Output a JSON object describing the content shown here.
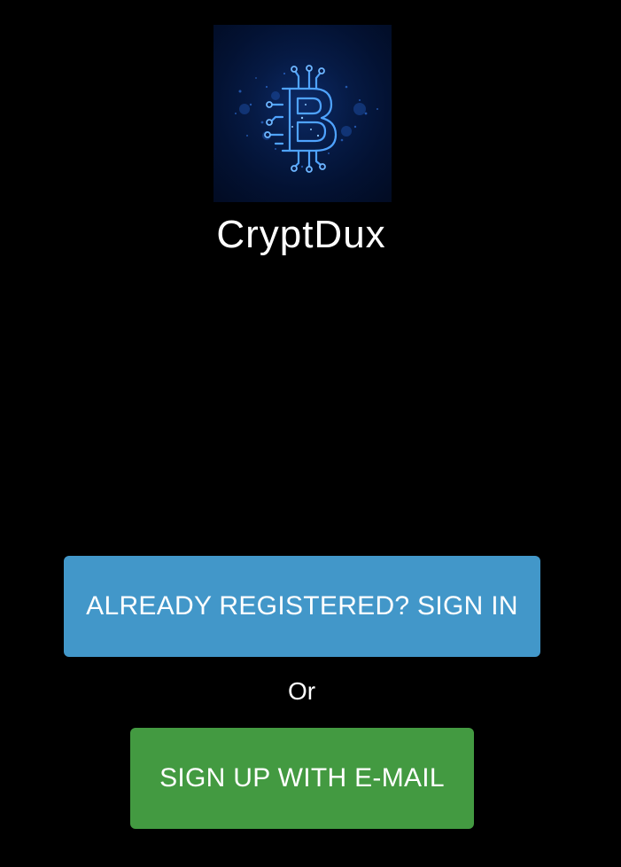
{
  "app": {
    "name": "CryptDux",
    "logo_icon": "bitcoin-circuit-icon"
  },
  "actions": {
    "sign_in_label": "ALREADY REGISTERED? SIGN IN",
    "or_label": "Or",
    "sign_up_label": "SIGN UP WITH E-MAIL"
  },
  "colors": {
    "background": "#000000",
    "sign_in_button": "#4297c9",
    "sign_up_button": "#439a41",
    "logo_glow": "#3d8bff"
  }
}
